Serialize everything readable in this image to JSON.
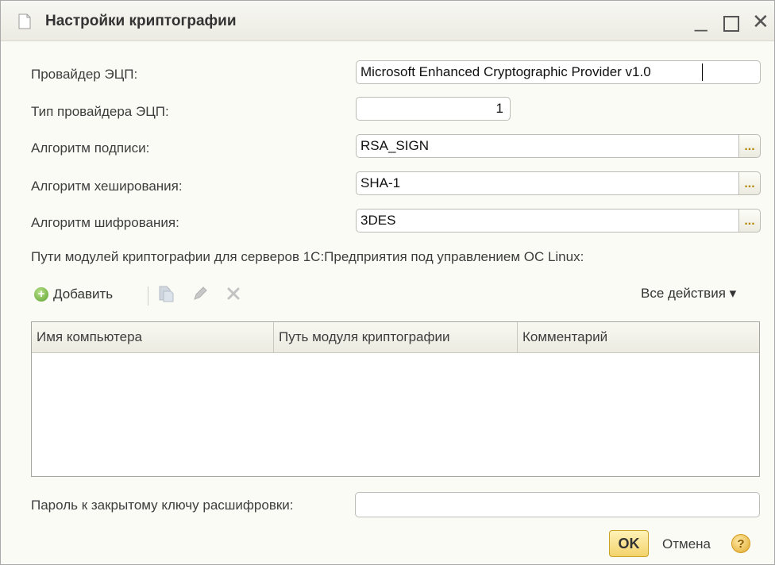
{
  "window": {
    "title": "Настройки криптографии",
    "minimize_glyph": "_",
    "maximize_glyph": "",
    "close_glyph": "✕"
  },
  "form": {
    "provider": {
      "label": "Провайдер ЭЦП:",
      "value": "Microsoft Enhanced Cryptographic Provider v1.0"
    },
    "provider_type": {
      "label": "Тип провайдера ЭЦП:",
      "value": "1"
    },
    "sign_algorithm": {
      "label": "Алгоритм подписи:",
      "value": "RSA_SIGN",
      "button": "..."
    },
    "hash_algorithm": {
      "label": "Алгоритм хеширования:",
      "value": "SHA-1",
      "button": "..."
    },
    "encryption_algorithm": {
      "label": "Алгоритм шифрования:",
      "value": "3DES",
      "button": "..."
    }
  },
  "modules": {
    "section_label": "Пути модулей криптографии для серверов 1С:Предприятия под управлением ОС Linux:",
    "toolbar": {
      "add_label": "Добавить",
      "all_actions_label": "Все действия ▾",
      "icons": [
        "plus-circle-icon",
        "copy-icon",
        "pencil-icon",
        "delete-x-icon"
      ]
    },
    "columns": [
      "Имя компьютера",
      "Путь модуля криптографии",
      "Комментарий"
    ],
    "rows": []
  },
  "password": {
    "label": "Пароль к закрытому ключу расшифровки:",
    "value": ""
  },
  "footer": {
    "ok_label": "OK",
    "cancel_label": "Отмена",
    "help_glyph": "?"
  },
  "colors": {
    "accent_button": "#f3d36b",
    "select_dots": "#b38600",
    "plus_icon": "#5aa22c"
  }
}
